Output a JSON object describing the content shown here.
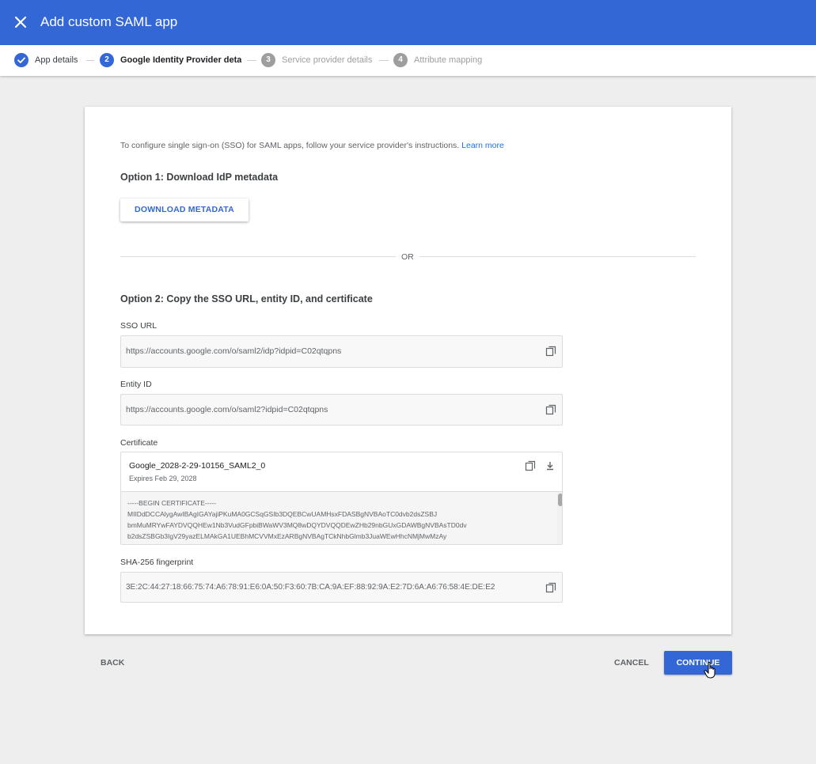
{
  "header": {
    "title": "Add custom SAML app"
  },
  "steps": [
    {
      "number": "",
      "label": "App details"
    },
    {
      "number": "2",
      "label": "Google Identity Provider details"
    },
    {
      "number": "3",
      "label": "Service provider details"
    },
    {
      "number": "4",
      "label": "Attribute mapping"
    }
  ],
  "colors": {
    "brand": "#3367d6",
    "inactive_step": "#9e9e9e"
  },
  "intro": {
    "text": "To configure single sign-on (SSO) for SAML apps, follow your service provider's instructions.",
    "link": "Learn more"
  },
  "option1": {
    "heading": "Option 1: Download IdP metadata",
    "button": "DOWNLOAD METADATA"
  },
  "divider": {
    "text": "OR"
  },
  "option2": {
    "heading": "Option 2: Copy the SSO URL, entity ID, and certificate"
  },
  "sso_url": {
    "label": "SSO URL",
    "value": "https://accounts.google.com/o/saml2/idp?idpid=C02qtqpns"
  },
  "entity_id": {
    "label": "Entity ID",
    "value": "https://accounts.google.com/o/saml2?idpid=C02qtqpns"
  },
  "certificate": {
    "label": "Certificate",
    "name": "Google_2028-2-29-10156_SAML2_0",
    "expiry": "Expires Feb 29, 2028",
    "lines": [
      "-----BEGIN CERTIFICATE-----",
      "MIIDdDCCAlygAwIBAgIGAYajiPKuMA0GCSqGSIb3DQEBCwUAMHsxFDASBgNVBAoTC0dvb2dsZSBJ",
      "bmMuMRYwFAYDVQQHEw1Nb3VudGFpbiBWaWV3MQ8wDQYDVQQDEwZHb29nbGUxGDAWBgNVBAsTD0dv",
      "b2dsZSBGb3IgV29yazELMAkGA1UEBhMCVVMxEzARBgNVBAgTCkNhbGlmb3JuaWEwHhcNMjMwMzAy"
    ]
  },
  "fingerprint": {
    "label": "SHA-256 fingerprint",
    "value": "3E:2C:44:27:18:66:75:74:A6:78:91:E6:0A:50:F3:60:7B:CA:9A:EF:88:92:9A:E2:7D:6A:A6:76:58:4E:DE:E2"
  },
  "footer": {
    "back": "BACK",
    "cancel": "CANCEL",
    "continue": "CONTINUE"
  }
}
